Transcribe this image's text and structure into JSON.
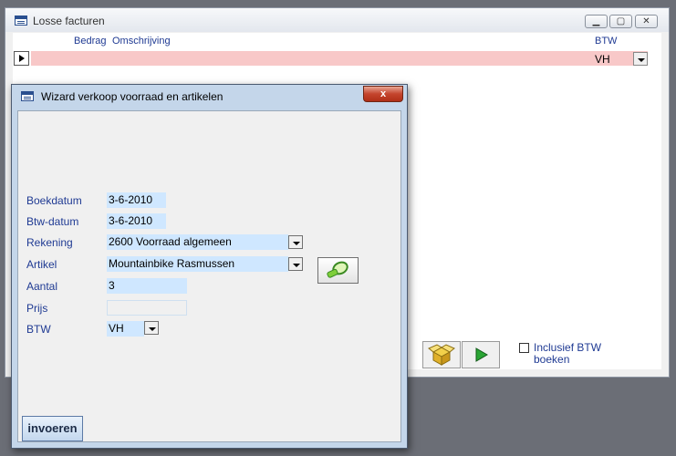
{
  "back_window": {
    "title": "Losse facturen",
    "columns": {
      "bedrag": "Bedrag",
      "omschrijving": "Omschrijving",
      "btw": "BTW"
    },
    "row": {
      "btw": "VH"
    },
    "checkbox": {
      "label_line1": "Inclusief BTW",
      "label_line2": "boeken",
      "checked": false
    }
  },
  "wizard": {
    "title": "Wizard verkoop voorraad en artikelen",
    "close_symbol": "x",
    "fields": {
      "boekdatum": {
        "label": "Boekdatum",
        "value": "3-6-2010"
      },
      "btw_datum": {
        "label": "Btw-datum",
        "value": "3-6-2010"
      },
      "rekening": {
        "label": "Rekening",
        "value": "2600  Voorraad algemeen"
      },
      "artikel": {
        "label": "Artikel",
        "value": "Mountainbike Rasmussen"
      },
      "aantal": {
        "label": "Aantal",
        "value": "3"
      },
      "prijs": {
        "label": "Prijs",
        "value": ""
      },
      "btw": {
        "label": "BTW",
        "value": "VH"
      }
    },
    "submit_label": "invoeren"
  },
  "colors": {
    "row_highlight": "#f8c8c8",
    "field_bg": "#cfe7ff",
    "label_blue": "#1f3a93"
  },
  "icons": [
    "form-icon",
    "minimize-icon",
    "maximize-icon",
    "close-icon",
    "dropdown-arrow-icon",
    "magnifier-icon",
    "box-icon",
    "play-icon"
  ]
}
